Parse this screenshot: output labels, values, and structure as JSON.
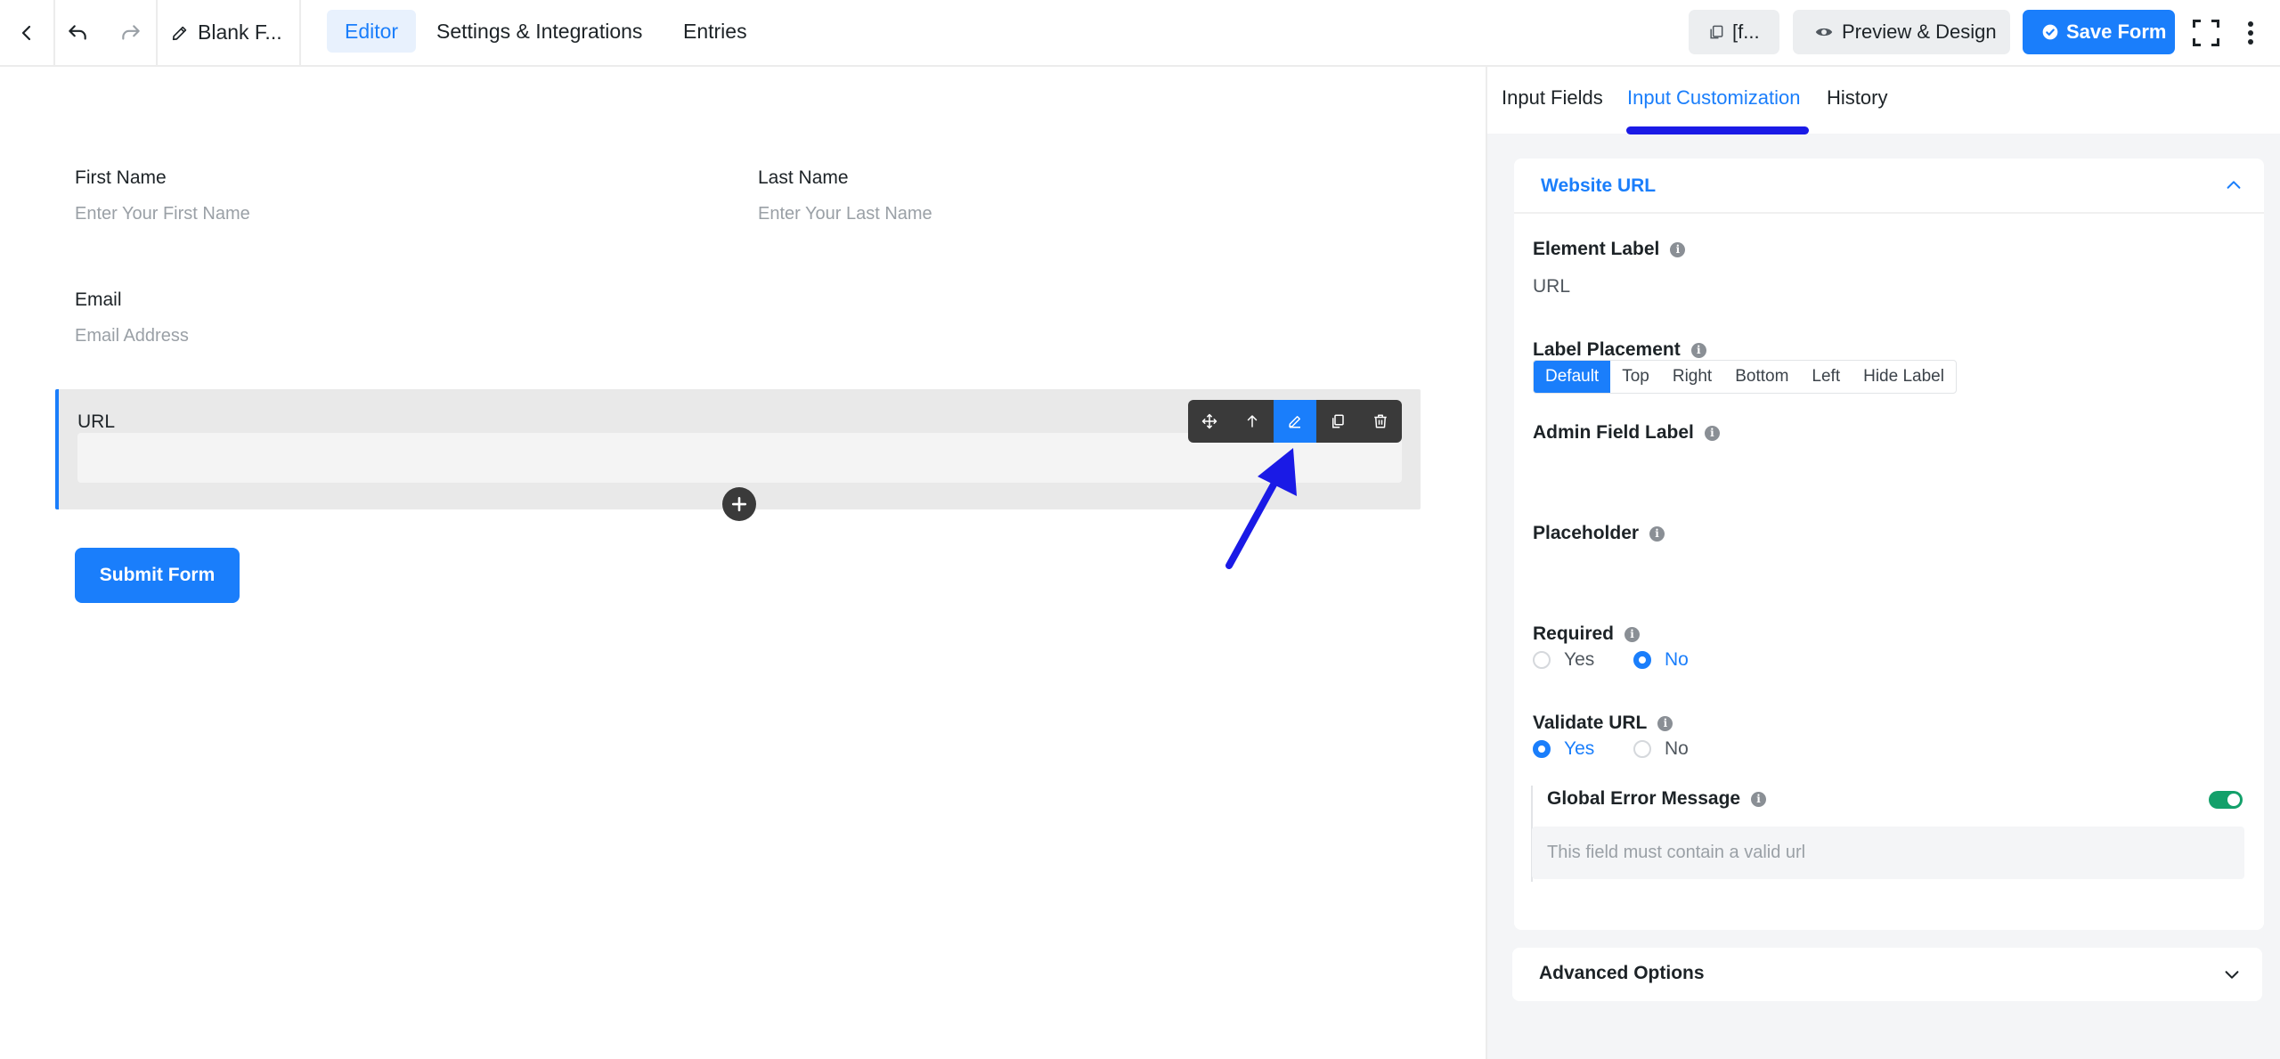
{
  "header": {
    "form_title": "Blank F...",
    "tabs": [
      {
        "label": "Editor",
        "active": true
      },
      {
        "label": "Settings & Integrations",
        "active": false
      },
      {
        "label": "Entries",
        "active": false
      }
    ],
    "shortcode_label": "[f...",
    "preview_label": "Preview & Design",
    "save_label": "Save Form"
  },
  "form": {
    "first_name": {
      "label": "First Name",
      "placeholder": "Enter Your First Name"
    },
    "last_name": {
      "label": "Last Name",
      "placeholder": "Enter Your Last Name"
    },
    "email": {
      "label": "Email",
      "placeholder": "Email Address"
    },
    "url": {
      "label": "URL"
    },
    "submit_label": "Submit Form"
  },
  "panel": {
    "tabs": [
      {
        "label": "Input Fields",
        "active": false
      },
      {
        "label": "Input Customization",
        "active": true
      },
      {
        "label": "History",
        "active": false
      }
    ],
    "section_title": "Website URL",
    "element_label": {
      "label": "Element Label",
      "value": "URL"
    },
    "label_placement": {
      "label": "Label Placement",
      "options": [
        "Default",
        "Top",
        "Right",
        "Bottom",
        "Left",
        "Hide Label"
      ],
      "selected": "Default"
    },
    "admin_field_label": {
      "label": "Admin Field Label",
      "value": ""
    },
    "placeholder": {
      "label": "Placeholder",
      "value": ""
    },
    "required": {
      "label": "Required",
      "options": [
        "Yes",
        "No"
      ],
      "selected": "No"
    },
    "validate_url": {
      "label": "Validate URL",
      "options": [
        "Yes",
        "No"
      ],
      "selected": "Yes"
    },
    "global_error": {
      "label": "Global Error Message",
      "enabled": true,
      "placeholder": "This field must contain a valid url"
    },
    "advanced_label": "Advanced Options"
  },
  "colors": {
    "accent": "#1a7efb",
    "toggle_on": "#13a06a",
    "annotation": "#1a1ae6"
  }
}
